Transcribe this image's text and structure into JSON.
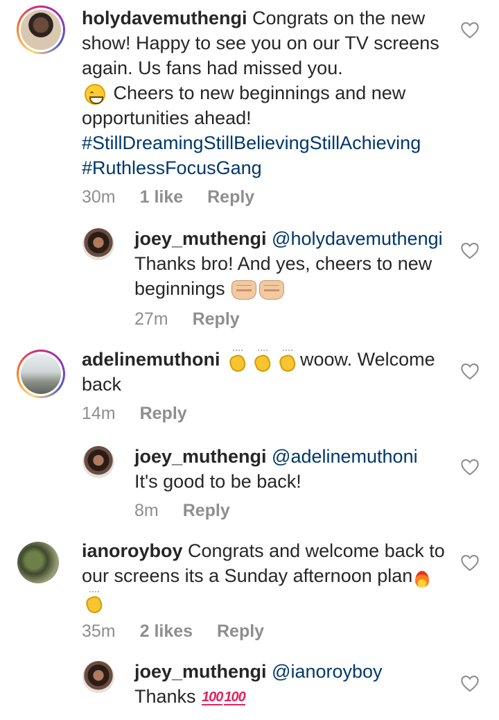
{
  "comments": [
    {
      "username": "holydavemuthengi",
      "text_1": "Congrats on the new show! Happy to see you on our TV screens again. Us fans had missed you.",
      "text_2": "Cheers to new beginnings and new opportunities ahead!",
      "tag_1": "#StillDreamingStillBelievingStillAchieving",
      "tag_2": "#RuthlessFocusGang",
      "time": "30m",
      "likes": "1 like",
      "reply": "Reply",
      "avatar_icon": "profile-photo-icon",
      "emoji_1": "grinning-face-icon"
    },
    {
      "username": "joey_muthengi",
      "mention": "@holydavemuthengi",
      "text": "Thanks bro! And yes, cheers to new beginnings",
      "time": "27m",
      "reply": "Reply",
      "emoji_1": "fist-bump-icon"
    },
    {
      "username": "adelinemuthoni",
      "text": "woow. Welcome back",
      "time": "14m",
      "reply": "Reply",
      "emoji_1": "clapping-hands-icon"
    },
    {
      "username": "joey_muthengi",
      "mention": "@adelinemuthoni",
      "text": "It's good to be back!",
      "time": "8m",
      "reply": "Reply"
    },
    {
      "username": "ianoroyboy",
      "text": "Congrats and welcome back to our screens its a Sunday afternoon plan",
      "time": "35m",
      "likes": "2 likes",
      "reply": "Reply",
      "emoji_1": "fire-icon",
      "emoji_2": "clapping-hands-icon"
    },
    {
      "username": "joey_muthengi",
      "mention": "@ianoroyboy",
      "text": "Thanks",
      "emoji_1": "hundred-points-icon",
      "hundred_label": "100"
    }
  ],
  "colors": {
    "text": "#262626",
    "meta": "#8e8e8e",
    "link": "#00376b"
  }
}
